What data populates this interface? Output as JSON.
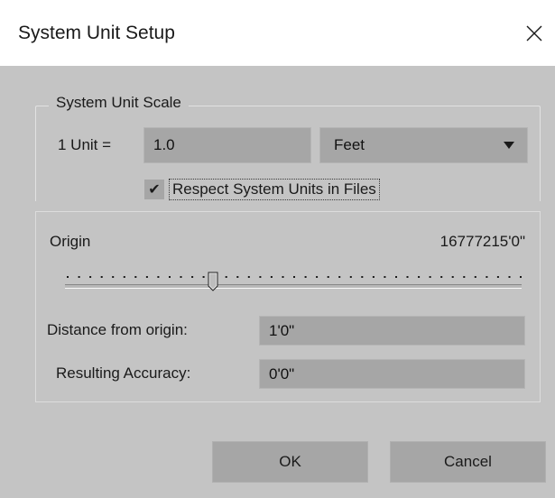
{
  "dialog": {
    "title": "System Unit Setup",
    "close_icon": "close-icon"
  },
  "system_unit_scale": {
    "group_label": "System Unit Scale",
    "unit_label": "1 Unit =",
    "unit_value": "1.0",
    "unit_type": "Feet",
    "dropdown_icon": "chevron-down-icon",
    "respect_checkbox": {
      "label": "Respect System Units in Files",
      "checked": true,
      "check_glyph": "✔"
    }
  },
  "origin": {
    "label": "Origin",
    "value": "16777215'0\"",
    "slider_position": 0.32,
    "distance_label": "Distance from origin:",
    "distance_value": "1'0\"",
    "accuracy_label": "Resulting Accuracy:",
    "accuracy_value": "0'0\""
  },
  "buttons": {
    "ok": "OK",
    "cancel": "Cancel"
  },
  "colors": {
    "background": "#c4c4c4",
    "field": "#a6a6a6",
    "titlebar": "#ffffff",
    "text": "#1a1a1a"
  }
}
